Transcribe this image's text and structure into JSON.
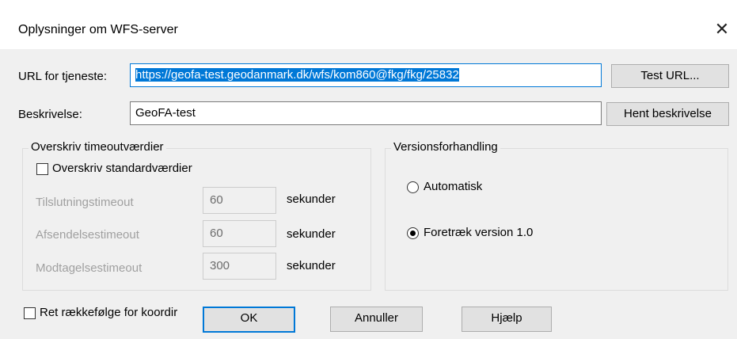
{
  "window": {
    "title": "Oplysninger om WFS-server",
    "close_glyph": "✕"
  },
  "url": {
    "label": "URL for tjeneste:",
    "value": "https://geofa-test.geodanmark.dk/wfs/kom860@fkg/fkg/25832",
    "test_button": "Test URL..."
  },
  "description": {
    "label": "Beskrivelse:",
    "value": "GeoFA-test",
    "fetch_button": "Hent beskrivelse"
  },
  "timeouts": {
    "legend": "Overskriv timeoutværdier",
    "override_label": "Overskriv standardværdier",
    "override_checked": false,
    "rows": [
      {
        "label": "Tilslutningstimeout",
        "value": "60",
        "unit": "sekunder"
      },
      {
        "label": "Afsendelsestimeout",
        "value": "60",
        "unit": "sekunder"
      },
      {
        "label": "Modtagelsestimeout",
        "value": "300",
        "unit": "sekunder"
      }
    ]
  },
  "version": {
    "legend": "Versionsforhandling",
    "options": [
      {
        "label": "Automatisk",
        "selected": false
      },
      {
        "label": "Foretræk version 1.0",
        "selected": true
      }
    ]
  },
  "coord_order": {
    "label": "Ret rækkefølge for koordir",
    "checked": false
  },
  "buttons": {
    "ok": "OK",
    "cancel": "Annuller",
    "help": "Hjælp"
  },
  "colors": {
    "accent": "#0078d7",
    "dialog_bg": "#f0f0f0"
  }
}
